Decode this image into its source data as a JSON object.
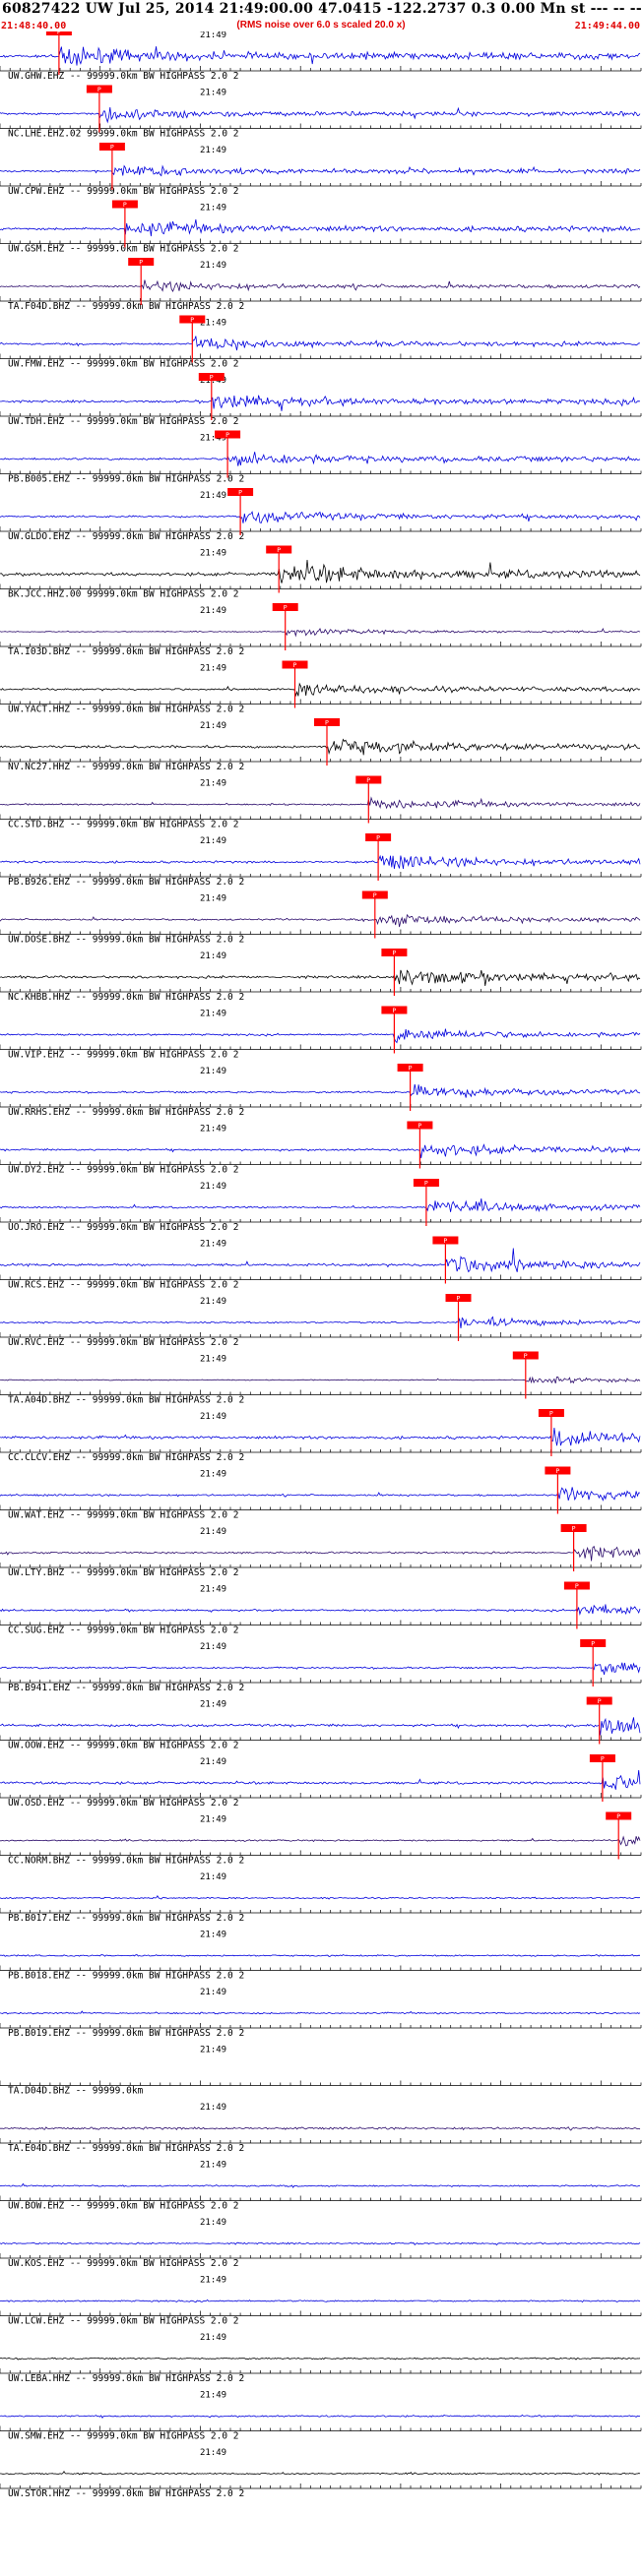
{
  "header": {
    "title": "60827422 UW Jul 25, 2014 21:49:00.00   47.0415 -122.2737  0.3 0.00 Mn st --- -- -- ---",
    "subtitle": "(RMS noise over 6.0 s scaled 20.0 x)",
    "time_start": "21:48:40.00",
    "time_end": "21:49:44.00"
  },
  "colors": {
    "blue_trace": "#0000dd",
    "black_trace": "#000000",
    "purple_trace": "#2a0a6a",
    "pick": "#ff0000",
    "axis": "#000000"
  },
  "chart_data": {
    "type": "line",
    "title": "60827422 UW Jul 25, 2014 21:49:00.00   47.0415 -122.2737  0.3 0.00 Mn st --- -- -- ---",
    "xlim": [
      "21:48:40.00",
      "21:49:44.00"
    ],
    "x_tick_label": "21:49",
    "grid": false,
    "channels": [
      {
        "label": "UW.GHW.EHZ -- 99999.0km BW  HIGHPASS  2.0  2",
        "pick": "P",
        "pick_frac": 0.092,
        "amp": 0.9,
        "color": "blue"
      },
      {
        "label": "NC.LHE.EHZ.02 99999.0km BW  HIGHPASS  2.0  2",
        "pick": "P",
        "pick_frac": 0.155,
        "amp": 0.6,
        "color": "blue"
      },
      {
        "label": "UW.CPW.EHZ -- 99999.0km BW  HIGHPASS  2.0  2",
        "pick": "P",
        "pick_frac": 0.175,
        "amp": 0.6,
        "color": "blue"
      },
      {
        "label": "UW.GSM.EHZ -- 99999.0km BW  HIGHPASS  2.0  2",
        "pick": "P",
        "pick_frac": 0.195,
        "amp": 0.7,
        "color": "blue"
      },
      {
        "label": "TA.F04D.BHZ -- 99999.0km BW  HIGHPASS  2.0  2",
        "pick": "P",
        "pick_frac": 0.22,
        "amp": 0.5,
        "color": "purple"
      },
      {
        "label": "UW.FMW.EHZ -- 99999.0km BW  HIGHPASS  2.0  2",
        "pick": "P",
        "pick_frac": 0.3,
        "amp": 0.6,
        "color": "blue"
      },
      {
        "label": "UW.TDH.EHZ -- 99999.0km BW  HIGHPASS  2.0  2",
        "pick": "P",
        "pick_frac": 0.33,
        "amp": 0.7,
        "color": "blue"
      },
      {
        "label": "PB.B005.EHZ -- 99999.0km BW  HIGHPASS  2.0  2",
        "pick": "P",
        "pick_frac": 0.355,
        "amp": 0.7,
        "color": "blue"
      },
      {
        "label": "UW.GLDO.EHZ -- 99999.0km BW  HIGHPASS  2.0  2",
        "pick": "P",
        "pick_frac": 0.375,
        "amp": 0.6,
        "color": "blue"
      },
      {
        "label": "BK.JCC.HHZ.00 99999.0km BW  HIGHPASS  2.0  2",
        "pick": "P",
        "pick_frac": 0.435,
        "amp": 1.0,
        "color": "black"
      },
      {
        "label": "TA.I03D.BHZ -- 99999.0km BW  HIGHPASS  2.0  2",
        "pick": "P",
        "pick_frac": 0.445,
        "amp": 0.3,
        "color": "purple"
      },
      {
        "label": "UW.YACT.HHZ -- 99999.0km BW  HIGHPASS  2.0  2",
        "pick": "P",
        "pick_frac": 0.46,
        "amp": 0.6,
        "color": "black"
      },
      {
        "label": "NV.NC27.HHZ -- 99999.0km BW  HIGHPASS  2.0  2",
        "pick": "P",
        "pick_frac": 0.51,
        "amp": 0.8,
        "color": "black"
      },
      {
        "label": "CC.STD.BHZ -- 99999.0km BW  HIGHPASS  2.0  2",
        "pick": "P",
        "pick_frac": 0.575,
        "amp": 0.5,
        "color": "purple"
      },
      {
        "label": "PB.B926.EHZ -- 99999.0km BW  HIGHPASS  2.0  2",
        "pick": "P",
        "pick_frac": 0.59,
        "amp": 0.7,
        "color": "blue"
      },
      {
        "label": "UW.DOSE.BHZ -- 99999.0km BW  HIGHPASS  2.0  2",
        "pick": "P",
        "pick_frac": 0.585,
        "amp": 0.6,
        "color": "purple"
      },
      {
        "label": "NC.KHBB.HHZ -- 99999.0km BW  HIGHPASS  2.0  2",
        "pick": "P",
        "pick_frac": 0.615,
        "amp": 0.8,
        "color": "black"
      },
      {
        "label": "UW.VIP.EHZ -- 99999.0km BW  HIGHPASS  2.0  2",
        "pick": "P",
        "pick_frac": 0.615,
        "amp": 0.6,
        "color": "blue"
      },
      {
        "label": "UW.RRHS.EHZ -- 99999.0km BW  HIGHPASS  2.0  2",
        "pick": "P",
        "pick_frac": 0.64,
        "amp": 0.6,
        "color": "blue"
      },
      {
        "label": "UW.DY2.EHZ -- 99999.0km BW  HIGHPASS  2.0  2",
        "pick": "P",
        "pick_frac": 0.655,
        "amp": 0.6,
        "color": "blue"
      },
      {
        "label": "UO.JRO.EHZ -- 99999.0km BW  HIGHPASS  2.0  2",
        "pick": "P",
        "pick_frac": 0.665,
        "amp": 0.6,
        "color": "blue"
      },
      {
        "label": "UW.RCS.EHZ -- 99999.0km BW  HIGHPASS  2.0  2",
        "pick": "P",
        "pick_frac": 0.695,
        "amp": 0.8,
        "color": "blue"
      },
      {
        "label": "UW.RVC.EHZ -- 99999.0km BW  HIGHPASS  2.0  2",
        "pick": "P",
        "pick_frac": 0.715,
        "amp": 0.5,
        "color": "blue"
      },
      {
        "label": "TA.A04D.BHZ -- 99999.0km BW  HIGHPASS  2.0  2",
        "pick": "P",
        "pick_frac": 0.82,
        "amp": 0.3,
        "color": "purple"
      },
      {
        "label": "CC.CLCV.EHZ -- 99999.0km BW  HIGHPASS  2.0  2",
        "pick": "P",
        "pick_frac": 0.86,
        "amp": 0.9,
        "color": "blue"
      },
      {
        "label": "UW.WAT.EHZ -- 99999.0km BW  HIGHPASS  2.0  2",
        "pick": "P",
        "pick_frac": 0.87,
        "amp": 0.6,
        "color": "blue"
      },
      {
        "label": "UW.LTY.BHZ -- 99999.0km BW  HIGHPASS  2.0  2",
        "pick": "P",
        "pick_frac": 0.895,
        "amp": 0.6,
        "color": "purple"
      },
      {
        "label": "CC.SUG.EHZ -- 99999.0km BW  HIGHPASS  2.0  2",
        "pick": "P",
        "pick_frac": 0.9,
        "amp": 0.6,
        "color": "blue"
      },
      {
        "label": "PB.B941.EHZ -- 99999.0km BW  HIGHPASS  2.0  2",
        "pick": "P",
        "pick_frac": 0.925,
        "amp": 0.6,
        "color": "blue"
      },
      {
        "label": "UW.OOW.EHZ -- 99999.0km BW  HIGHPASS  2.0  2",
        "pick": "P",
        "pick_frac": 0.935,
        "amp": 0.8,
        "color": "blue"
      },
      {
        "label": "UW.OSD.EHZ -- 99999.0km BW  HIGHPASS  2.0  2",
        "pick": "P",
        "pick_frac": 0.94,
        "amp": 0.8,
        "color": "blue"
      },
      {
        "label": "CC.NORM.BHZ -- 99999.0km BW  HIGHPASS  2.0  2",
        "pick": "P",
        "pick_frac": 0.965,
        "amp": 0.5,
        "color": "purple"
      },
      {
        "label": "PB.B017.EHZ -- 99999.0km BW  HIGHPASS  2.0  2",
        "pick": "",
        "pick_frac": null,
        "amp": 0.5,
        "color": "blue"
      },
      {
        "label": "PB.B018.EHZ -- 99999.0km BW  HIGHPASS  2.0  2",
        "pick": "",
        "pick_frac": null,
        "amp": 0.5,
        "color": "blue"
      },
      {
        "label": "PB.B019.EHZ -- 99999.0km BW  HIGHPASS  2.0  2",
        "pick": "",
        "pick_frac": null,
        "amp": 0.5,
        "color": "blue"
      },
      {
        "label": "TA.D04D.BHZ -- 99999.0km",
        "pick": "",
        "pick_frac": null,
        "amp": 0.0,
        "color": "purple"
      },
      {
        "label": "TA.E04D.BHZ -- 99999.0km BW  HIGHPASS  2.0  2",
        "pick": "",
        "pick_frac": null,
        "amp": 0.7,
        "color": "purple"
      },
      {
        "label": "UW.BOW.EHZ -- 99999.0km BW  HIGHPASS  2.0  2",
        "pick": "",
        "pick_frac": null,
        "amp": 0.5,
        "color": "blue"
      },
      {
        "label": "UW.KOS.EHZ -- 99999.0km BW  HIGHPASS  2.0  2",
        "pick": "",
        "pick_frac": null,
        "amp": 0.5,
        "color": "blue"
      },
      {
        "label": "UW.LCW.EHZ -- 99999.0km BW  HIGHPASS  2.0  2",
        "pick": "",
        "pick_frac": null,
        "amp": 0.5,
        "color": "blue"
      },
      {
        "label": "UW.LEBA.HHZ -- 99999.0km BW  HIGHPASS  2.0  2",
        "pick": "",
        "pick_frac": null,
        "amp": 0.5,
        "color": "black"
      },
      {
        "label": "UW.SMW.EHZ -- 99999.0km BW  HIGHPASS  2.0  2",
        "pick": "",
        "pick_frac": null,
        "amp": 0.5,
        "color": "blue"
      },
      {
        "label": "UW.STOR.HHZ -- 99999.0km BW  HIGHPASS  2.0  2",
        "pick": "",
        "pick_frac": null,
        "amp": 0.5,
        "color": "black"
      }
    ]
  }
}
